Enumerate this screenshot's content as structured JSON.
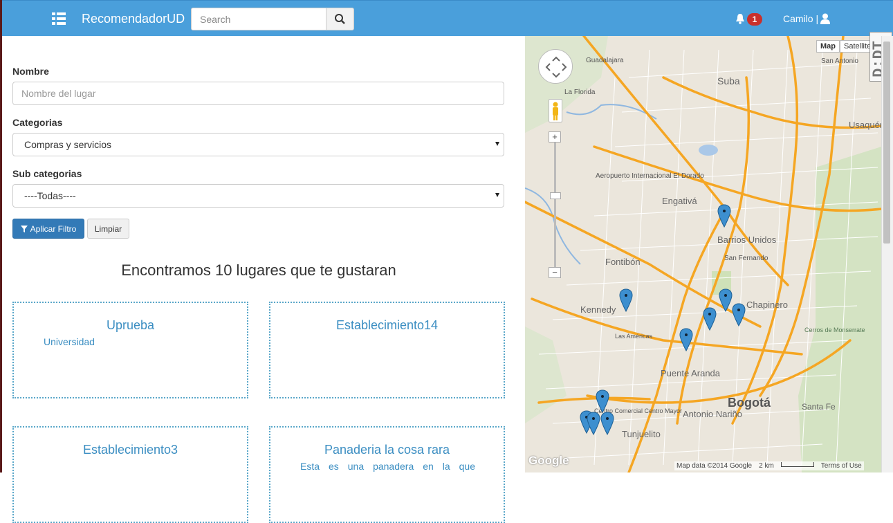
{
  "header": {
    "brand": "RecomendadorUD",
    "search_placeholder": "Search",
    "notification_count": "1",
    "user_label": "Camilo |"
  },
  "filters": {
    "name_label": "Nombre",
    "name_placeholder": "Nombre del lugar",
    "category_label": "Categorias",
    "category_value": "Compras y servicios",
    "subcategory_label": "Sub categorias",
    "subcategory_value": "----Todas----",
    "apply_label": "Aplicar Filtro",
    "clear_label": "Limpiar"
  },
  "results": {
    "heading": "Encontramos 10 lugares que te gustaran",
    "cards": [
      {
        "title": "Uprueba",
        "subtitle": "Universidad"
      },
      {
        "title": "Establecimiento14",
        "subtitle": ""
      },
      {
        "title": "Establecimiento3",
        "subtitle": ""
      },
      {
        "title": "Panaderia la cosa rara",
        "subtitle": "Esta es una panadera en la que"
      }
    ]
  },
  "map": {
    "type_map": "Map",
    "type_satellite": "Satellite",
    "plugin_label": "D:DT",
    "attribution": "Map data ©2014 Google",
    "scale": "2 km",
    "terms": "Terms of Use",
    "google_logo": "Google",
    "labels": [
      {
        "text": "Guadalajara"
      },
      {
        "text": "Suba"
      },
      {
        "text": "San Antonio"
      },
      {
        "text": "La Florida"
      },
      {
        "text": "Usaquén"
      },
      {
        "text": "Engativá"
      },
      {
        "text": "Aeropuerto Internacional El Dorado"
      },
      {
        "text": "Barrios Unidos"
      },
      {
        "text": "Fontibón"
      },
      {
        "text": "San Fernando"
      },
      {
        "text": "Kennedy"
      },
      {
        "text": "Chapinero"
      },
      {
        "text": "Puente Aranda"
      },
      {
        "text": "Bogotá"
      },
      {
        "text": "Antonio Nariño"
      },
      {
        "text": "Tunjuelito"
      },
      {
        "text": "Santa Fe"
      },
      {
        "text": "Cerros de Monserrate"
      },
      {
        "text": "Centro Comercial Centro Mayor"
      },
      {
        "text": "Las Américas"
      }
    ],
    "pin_color": "#3d8fcf"
  },
  "colors": {
    "navbar": "#4a9fdb",
    "primary_button": "#337ab7",
    "link": "#3b8ec2",
    "road": "#f5a623"
  }
}
